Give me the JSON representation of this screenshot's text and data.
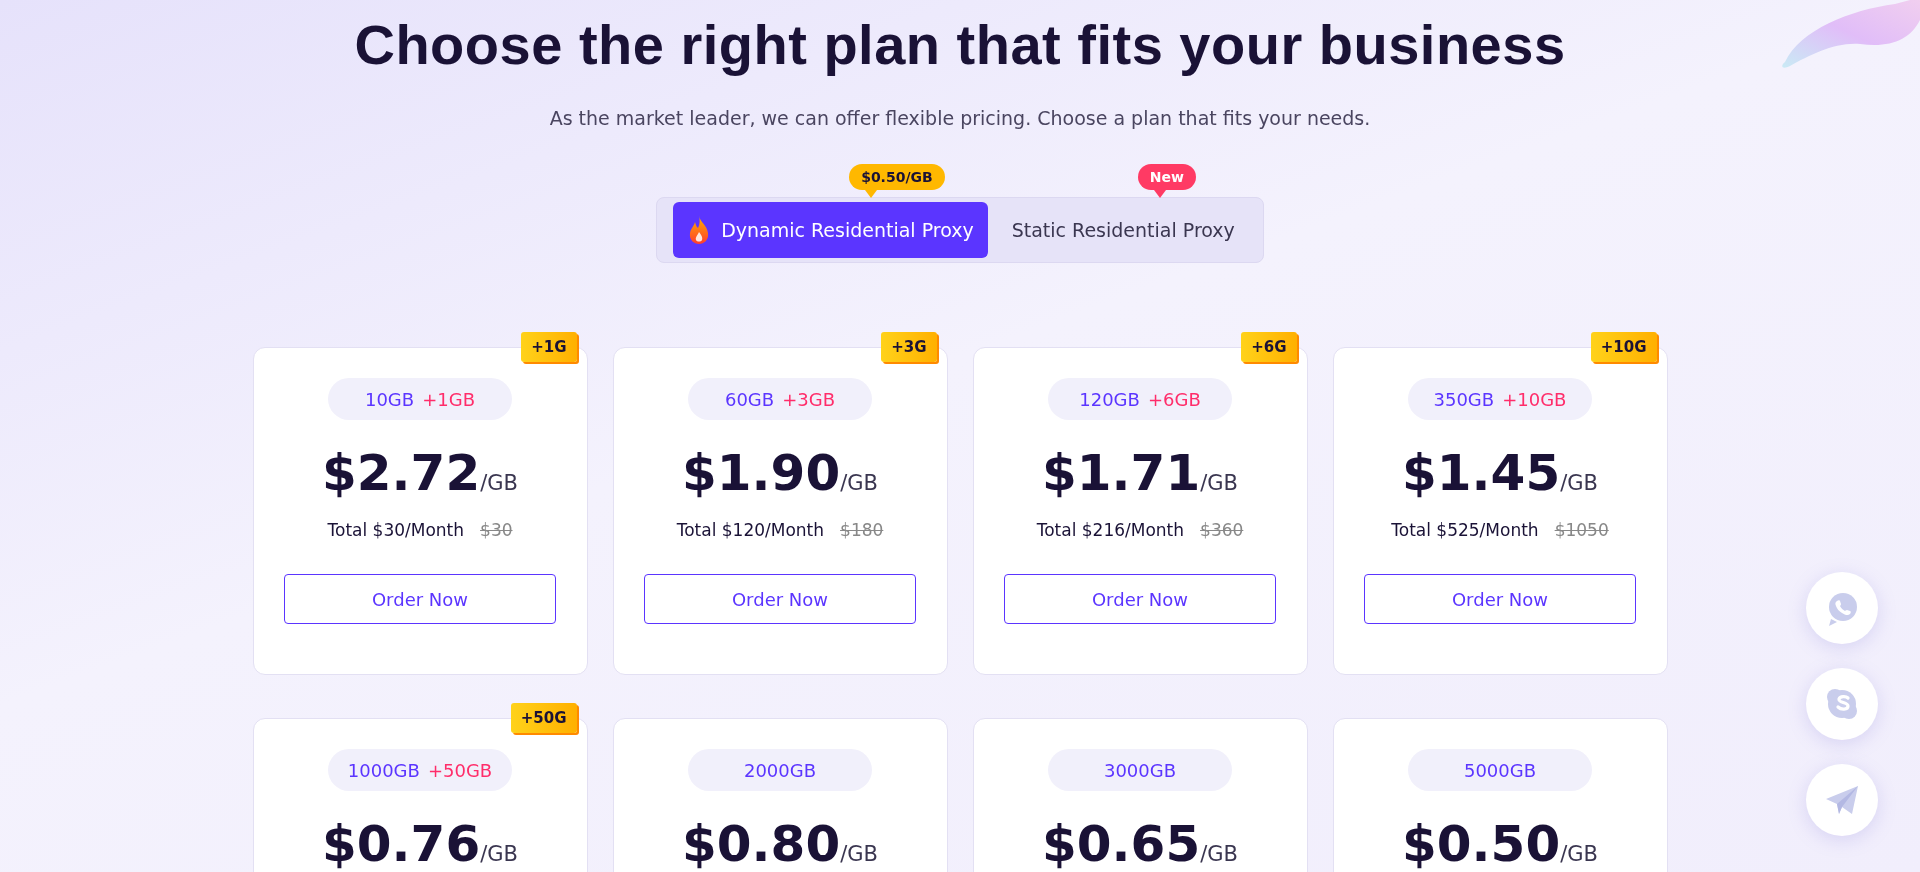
{
  "heading": "Choose the right plan that fits your business",
  "subheading": "As the market leader, we can offer flexible pricing. Choose a plan that fits your needs.",
  "tabs": [
    {
      "label": "Dynamic Residential Proxy",
      "selected": true,
      "badge": {
        "text": "$0.50/GB",
        "color": "#ffb800"
      }
    },
    {
      "label": "Static Residential Proxy",
      "selected": false,
      "badge": {
        "text": "New",
        "color": "#ff3a64"
      }
    }
  ],
  "plans": [
    {
      "ribbon": "+1G",
      "amount": "10GB",
      "bonus": "+1GB",
      "price": "$2.72",
      "unit": "/GB",
      "total": "Total $30/Month",
      "old_price": "$30",
      "button": "Order Now"
    },
    {
      "ribbon": "+3G",
      "amount": "60GB",
      "bonus": "+3GB",
      "price": "$1.90",
      "unit": "/GB",
      "total": "Total $120/Month",
      "old_price": "$180",
      "button": "Order Now"
    },
    {
      "ribbon": "+6G",
      "amount": "120GB",
      "bonus": "+6GB",
      "price": "$1.71",
      "unit": "/GB",
      "total": "Total $216/Month",
      "old_price": "$360",
      "button": "Order Now"
    },
    {
      "ribbon": "+10G",
      "amount": "350GB",
      "bonus": "+10GB",
      "price": "$1.45",
      "unit": "/GB",
      "total": "Total $525/Month",
      "old_price": "$1050",
      "button": "Order Now"
    },
    {
      "ribbon": "+50G",
      "amount": "1000GB",
      "bonus": "+50GB",
      "price": "$0.76",
      "unit": "/GB"
    },
    {
      "amount": "2000GB",
      "price": "$0.80",
      "unit": "/GB"
    },
    {
      "amount": "3000GB",
      "price": "$0.65",
      "unit": "/GB"
    },
    {
      "amount": "5000GB",
      "price": "$0.50",
      "unit": "/GB"
    }
  ],
  "contact_buttons": [
    {
      "kind": "whatsapp"
    },
    {
      "kind": "skype"
    },
    {
      "kind": "telegram"
    }
  ]
}
